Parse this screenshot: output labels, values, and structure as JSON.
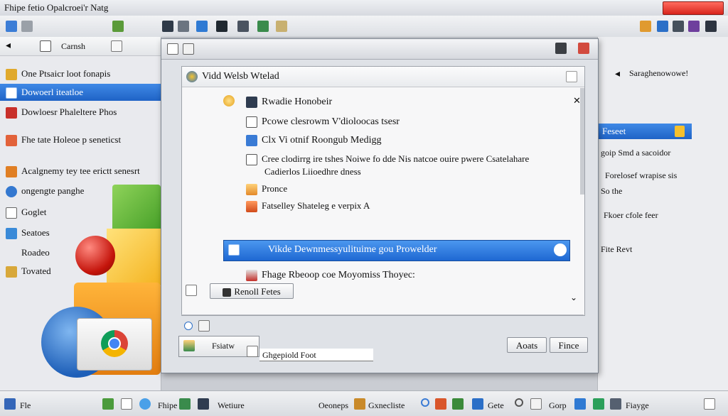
{
  "window": {
    "title": "Fhipe fetio Opalcroei'r Natg"
  },
  "toolbar": {
    "label": "Carnsh"
  },
  "sidebar": {
    "items": [
      {
        "label": "One Ptsaicr loot fonapis",
        "selected": false
      },
      {
        "label": "Dowoerl iteatloe",
        "selected": true
      },
      {
        "label": "Dowloesr Phaleltere Phos",
        "selected": false
      },
      {
        "label": "Fhe tate Holeoe p seneticst",
        "selected": false
      },
      {
        "label": "Acalgnemy tey tee erictt senesrt",
        "selected": false
      },
      {
        "label": "ongengte panghe",
        "selected": false
      },
      {
        "label": "Goglet",
        "selected": false
      },
      {
        "label": "Seatoes",
        "selected": false
      },
      {
        "label": "Roadeo",
        "selected": false
      },
      {
        "label": "Tovated",
        "selected": false
      }
    ]
  },
  "dialog": {
    "header_title": "Vidd Welsb Wtelad",
    "rows": [
      {
        "label": "Rwadie Honobeir",
        "icon": "monitor-icon"
      },
      {
        "label": "Pcowe clesrowm V'dioloocas tsesr",
        "icon": "document-icon"
      },
      {
        "label": "Clx  Vi otnif Roongub Medigg",
        "icon": "video-icon"
      },
      {
        "label": "Cree clodirrg ire tshes Noiwe fo dde Nis natcoe ouire pwere Csatelahare",
        "icon": "document-icon"
      },
      {
        "label": "Cadierlos Liioedhre dness",
        "icon": ""
      },
      {
        "label": "Pronce",
        "icon": "folder-icon"
      },
      {
        "label": "Fatselley Shateleg e verpix A",
        "icon": "folder-icon"
      },
      {
        "label": "Vikde Dewnmessyulituime gou Prowelder",
        "icon": "download-icon",
        "selected": true
      },
      {
        "label": "Fhage Rbeoop coe Moyomiss Thoyec:",
        "icon": "install-icon"
      }
    ],
    "rename_button": "Renoll Fetes",
    "path_label": "Fsiatw",
    "path_value": "Ghgepiold Foot",
    "cancel_button": "Aoats",
    "finish_button": "Fince"
  },
  "right_pane": {
    "items": [
      "Saraghenowowe!",
      "Feseet",
      "goip Smd a sacoidor",
      "Forelosef wrapise sis",
      "So the",
      "Fkoer cfole feer",
      "Fite Revt"
    ]
  },
  "taskbar": {
    "start_label": "Fle",
    "items": [
      "Fhipe",
      "Wetiure",
      "Oeoneps",
      "Gxnecliste",
      "Gete",
      "Gorp",
      "Fiayge"
    ]
  },
  "colors": {
    "accent": "#1f63c6",
    "close": "#d8251c"
  }
}
